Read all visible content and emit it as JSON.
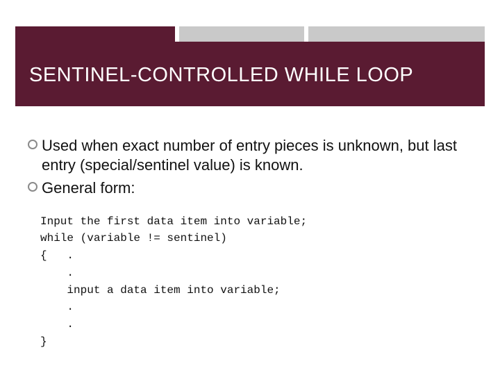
{
  "title": "SENTINEL-CONTROLLED WHILE LOOP",
  "bullets": [
    "Used when exact number of entry pieces is unknown, but last entry (special/sentinel value) is known.",
    "General form:"
  ],
  "code": {
    "l1": "Input the first data item into variable;",
    "l2": "while (variable != sentinel)",
    "l3": "{   .",
    "l4": "    .",
    "l5": "    input a data item into variable;",
    "l6": "    .",
    "l7": "    .",
    "l8": "}"
  }
}
